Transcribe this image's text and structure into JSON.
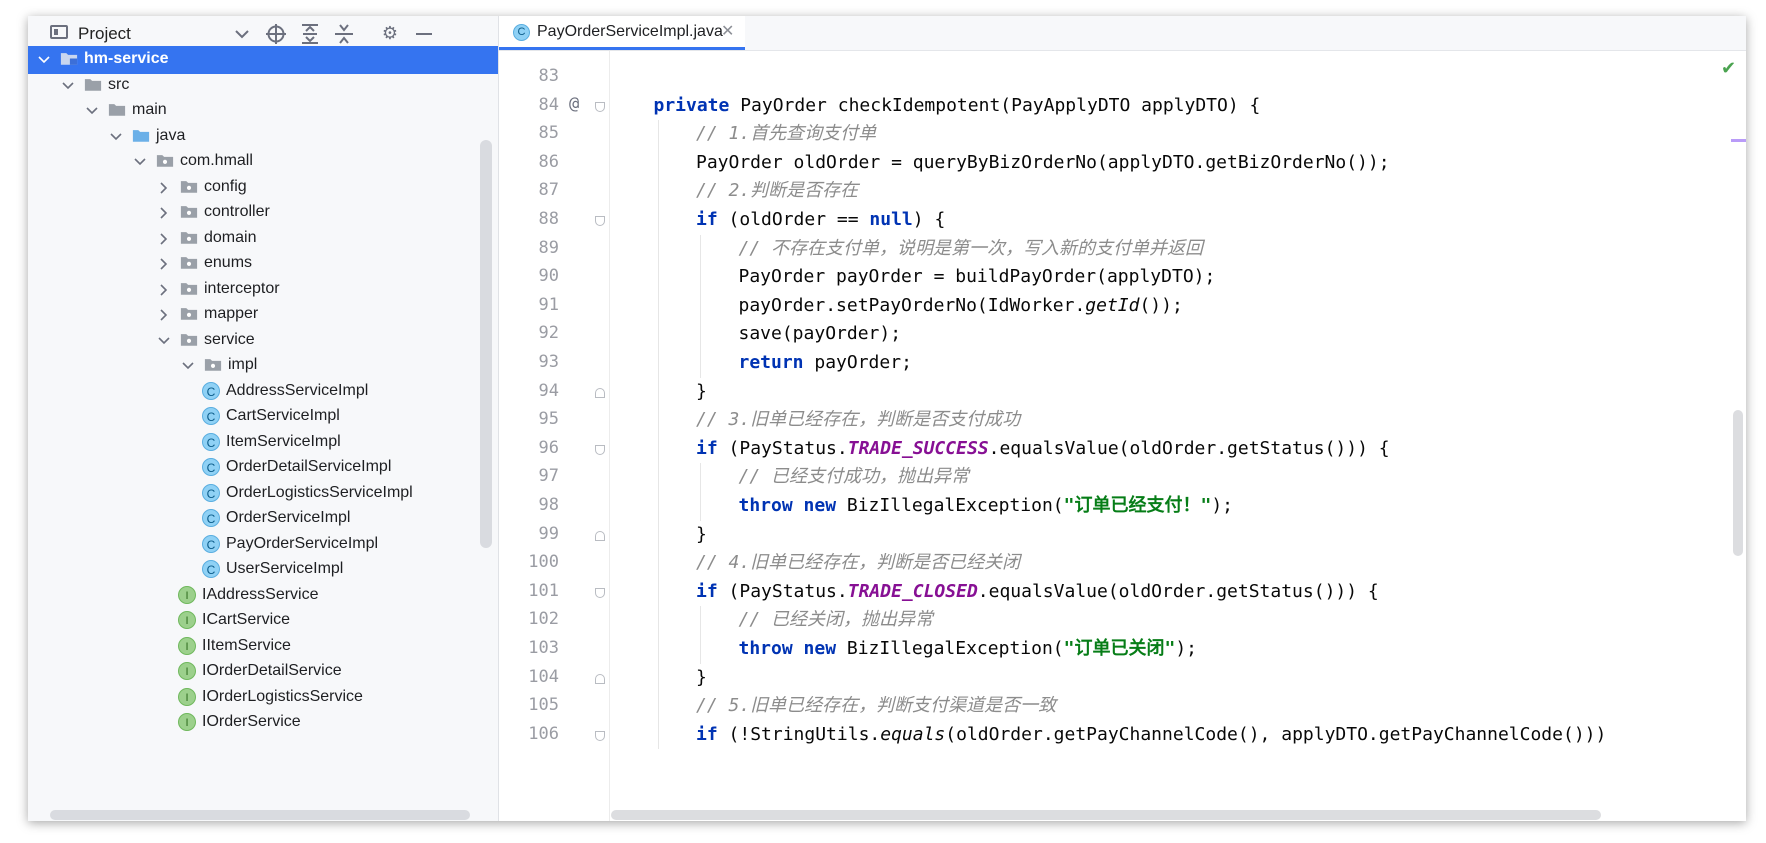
{
  "project_panel": {
    "tab_label": "Project",
    "header_icons": [
      "chevron-down-icon",
      "locate-icon",
      "expand-all-icon",
      "collapse-all-icon",
      "gear-icon",
      "minimize-icon"
    ],
    "tree": [
      {
        "label": "hm-service",
        "depth": 0,
        "type": "module",
        "expanded": true,
        "selected": true
      },
      {
        "label": "src",
        "depth": 1,
        "type": "folder",
        "expanded": true
      },
      {
        "label": "main",
        "depth": 2,
        "type": "folder",
        "expanded": true
      },
      {
        "label": "java",
        "depth": 3,
        "type": "source-folder",
        "expanded": true
      },
      {
        "label": "com.hmall",
        "depth": 4,
        "type": "package",
        "expanded": true
      },
      {
        "label": "config",
        "depth": 5,
        "type": "package",
        "expanded": false
      },
      {
        "label": "controller",
        "depth": 5,
        "type": "package",
        "expanded": false
      },
      {
        "label": "domain",
        "depth": 5,
        "type": "package",
        "expanded": false
      },
      {
        "label": "enums",
        "depth": 5,
        "type": "package",
        "expanded": false
      },
      {
        "label": "interceptor",
        "depth": 5,
        "type": "package",
        "expanded": false
      },
      {
        "label": "mapper",
        "depth": 5,
        "type": "package",
        "expanded": false
      },
      {
        "label": "service",
        "depth": 5,
        "type": "package",
        "expanded": true
      },
      {
        "label": "impl",
        "depth": 6,
        "type": "package",
        "expanded": true
      },
      {
        "label": "AddressServiceImpl",
        "depth": 7,
        "type": "class"
      },
      {
        "label": "CartServiceImpl",
        "depth": 7,
        "type": "class"
      },
      {
        "label": "ItemServiceImpl",
        "depth": 7,
        "type": "class"
      },
      {
        "label": "OrderDetailServiceImpl",
        "depth": 7,
        "type": "class"
      },
      {
        "label": "OrderLogisticsServiceImpl",
        "depth": 7,
        "type": "class"
      },
      {
        "label": "OrderServiceImpl",
        "depth": 7,
        "type": "class"
      },
      {
        "label": "PayOrderServiceImpl",
        "depth": 7,
        "type": "class"
      },
      {
        "label": "UserServiceImpl",
        "depth": 7,
        "type": "class"
      },
      {
        "label": "IAddressService",
        "depth": 6,
        "type": "interface"
      },
      {
        "label": "ICartService",
        "depth": 6,
        "type": "interface"
      },
      {
        "label": "IItemService",
        "depth": 6,
        "type": "interface"
      },
      {
        "label": "IOrderDetailService",
        "depth": 6,
        "type": "interface"
      },
      {
        "label": "IOrderLogisticsService",
        "depth": 6,
        "type": "interface"
      },
      {
        "label": "IOrderService",
        "depth": 6,
        "type": "interface"
      }
    ]
  },
  "editor": {
    "tab_label": "PayOrderServiceImpl.java",
    "tab_icon_letter": "C",
    "class_icon_letter": "C",
    "interface_icon_letter": "I",
    "override_marker": "@",
    "inspection_status": "ok-check-icon",
    "lines": [
      {
        "n": "83",
        "indent": 0,
        "tokens": []
      },
      {
        "n": "84",
        "indent": 1,
        "tokens": [
          [
            "kw",
            "private"
          ],
          [
            "p",
            " PayOrder checkIdempotent(PayApplyDTO applyDTO) {"
          ]
        ]
      },
      {
        "n": "85",
        "indent": 2,
        "tokens": [
          [
            "cm",
            "// 1.首先查询支付单"
          ]
        ]
      },
      {
        "n": "86",
        "indent": 2,
        "tokens": [
          [
            "p",
            "PayOrder oldOrder = queryByBizOrderNo(applyDTO.getBizOrderNo());"
          ]
        ]
      },
      {
        "n": "87",
        "indent": 2,
        "tokens": [
          [
            "cm",
            "// 2.判断是否存在"
          ]
        ]
      },
      {
        "n": "88",
        "indent": 2,
        "tokens": [
          [
            "kw",
            "if"
          ],
          [
            "p",
            " (oldOrder == "
          ],
          [
            "kw",
            "null"
          ],
          [
            "p",
            ") {"
          ]
        ]
      },
      {
        "n": "89",
        "indent": 3,
        "tokens": [
          [
            "cm",
            "// 不存在支付单，说明是第一次，写入新的支付单并返回"
          ]
        ]
      },
      {
        "n": "90",
        "indent": 3,
        "tokens": [
          [
            "p",
            "PayOrder payOrder = buildPayOrder(applyDTO);"
          ]
        ]
      },
      {
        "n": "91",
        "indent": 3,
        "tokens": [
          [
            "p",
            "payOrder.setPayOrderNo(IdWorker."
          ],
          [
            "it",
            "getId"
          ],
          [
            "p",
            "());"
          ]
        ]
      },
      {
        "n": "92",
        "indent": 3,
        "tokens": [
          [
            "p",
            "save(payOrder);"
          ]
        ]
      },
      {
        "n": "93",
        "indent": 3,
        "tokens": [
          [
            "kw",
            "return"
          ],
          [
            "p",
            " payOrder;"
          ]
        ]
      },
      {
        "n": "94",
        "indent": 2,
        "tokens": [
          [
            "p",
            "}"
          ]
        ]
      },
      {
        "n": "95",
        "indent": 2,
        "tokens": [
          [
            "cm",
            "// 3.旧单已经存在，判断是否支付成功"
          ]
        ]
      },
      {
        "n": "96",
        "indent": 2,
        "tokens": [
          [
            "kw",
            "if"
          ],
          [
            "p",
            " (PayStatus."
          ],
          [
            "cn",
            "TRADE_SUCCESS"
          ],
          [
            "p",
            ".equalsValue(oldOrder.getStatus())) {"
          ]
        ]
      },
      {
        "n": "97",
        "indent": 3,
        "tokens": [
          [
            "cm",
            "// 已经支付成功，抛出异常"
          ]
        ]
      },
      {
        "n": "98",
        "indent": 3,
        "tokens": [
          [
            "kw",
            "throw new"
          ],
          [
            "p",
            " BizIllegalException("
          ],
          [
            "st",
            "\"订单已经支付！\""
          ],
          [
            "p",
            ");"
          ]
        ]
      },
      {
        "n": "99",
        "indent": 2,
        "tokens": [
          [
            "p",
            "}"
          ]
        ]
      },
      {
        "n": "100",
        "indent": 2,
        "tokens": [
          [
            "cm",
            "// 4.旧单已经存在，判断是否已经关闭"
          ]
        ]
      },
      {
        "n": "101",
        "indent": 2,
        "tokens": [
          [
            "kw",
            "if"
          ],
          [
            "p",
            " (PayStatus."
          ],
          [
            "cn",
            "TRADE_CLOSED"
          ],
          [
            "p",
            ".equalsValue(oldOrder.getStatus())) {"
          ]
        ]
      },
      {
        "n": "102",
        "indent": 3,
        "tokens": [
          [
            "cm",
            "// 已经关闭，抛出异常"
          ]
        ]
      },
      {
        "n": "103",
        "indent": 3,
        "tokens": [
          [
            "kw",
            "throw new"
          ],
          [
            "p",
            " BizIllegalException("
          ],
          [
            "st",
            "\"订单已关闭\""
          ],
          [
            "p",
            ");"
          ]
        ]
      },
      {
        "n": "104",
        "indent": 2,
        "tokens": [
          [
            "p",
            "}"
          ]
        ]
      },
      {
        "n": "105",
        "indent": 2,
        "tokens": [
          [
            "cm",
            "// 5.旧单已经存在，判断支付渠道是否一致"
          ]
        ]
      },
      {
        "n": "106",
        "indent": 2,
        "tokens": [
          [
            "kw",
            "if"
          ],
          [
            "p",
            " (!StringUtils."
          ],
          [
            "it",
            "equals"
          ],
          [
            "p",
            "(oldOrder.getPayChannelCode(), applyDTO.getPayChannelCode()))"
          ]
        ]
      }
    ],
    "override_line": "84",
    "fold_open_lines": [
      "84",
      "88",
      "96",
      "101",
      "106"
    ],
    "fold_close_lines": [
      "94",
      "99",
      "104"
    ]
  }
}
